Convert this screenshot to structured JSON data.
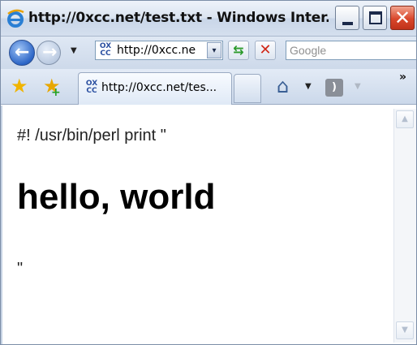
{
  "window": {
    "title": "http://0xcc.net/test.txt - Windows Inter..."
  },
  "address_bar": {
    "site_icon_text": "OX\nCC",
    "url": "http://0xcc.ne",
    "dropdown_glyph": "▾",
    "refresh_glyph": "⇆",
    "stop_glyph": "✕"
  },
  "search": {
    "placeholder": "Google"
  },
  "tab": {
    "label": "http://0xcc.net/tes..."
  },
  "toolbar": {
    "chevrons": "»"
  },
  "content": {
    "line1": "#! /usr/bin/perl print \"",
    "heading": "hello, world",
    "line3": "\""
  },
  "icons": {
    "ie_logo": "ie-logo-icon",
    "back": "back-arrow-icon",
    "forward": "forward-arrow-icon",
    "favorites": "star-icon",
    "add_favorites": "add-favorite-icon",
    "home": "home-icon",
    "feeds": "rss-icon"
  }
}
